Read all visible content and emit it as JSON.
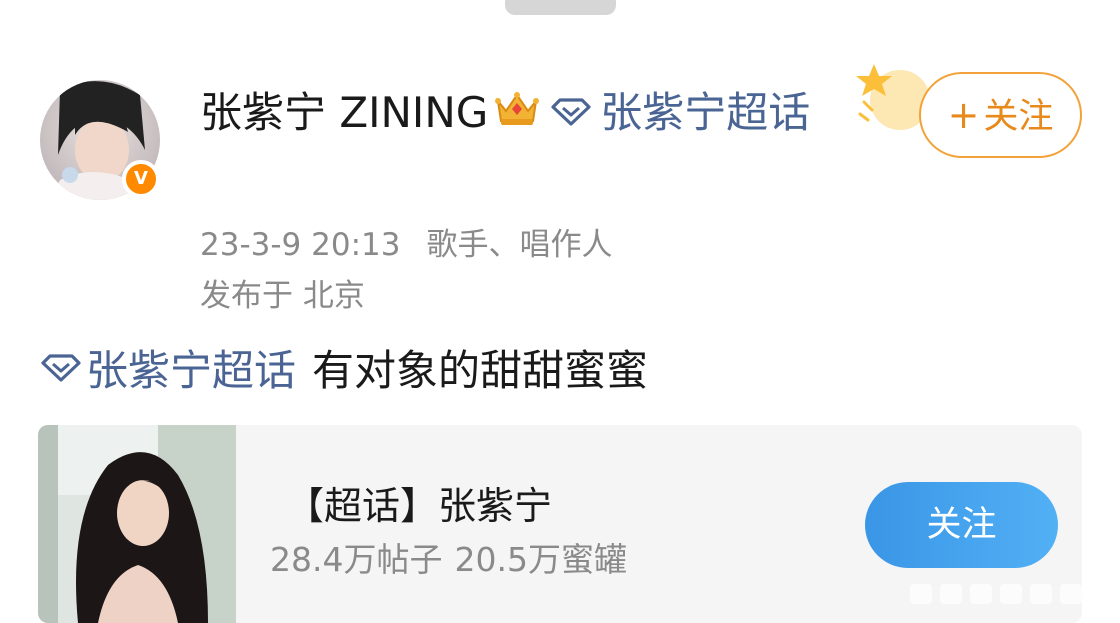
{
  "post": {
    "author": {
      "name": "张紫宁 ZINING",
      "topic_link": "张紫宁超话",
      "verified_badge": "V"
    },
    "timestamp": "23-3-9 20:13",
    "author_title": "歌手、唱作人",
    "location": "发布于 北京",
    "follow_button": {
      "plus": "+",
      "label": "关注"
    },
    "content": {
      "topic_link": "张紫宁超话",
      "text": "有对象的甜甜蜜蜜"
    }
  },
  "topic_card": {
    "title": "【超话】张紫宁",
    "posts_count": "28.4万帖子",
    "fans_count": "20.5万蜜罐",
    "follow_label": "关注"
  },
  "colors": {
    "topic_link": "#4a6494",
    "follow_orange": "#e8891b",
    "card_follow_blue": "#3a96e6",
    "meta_gray": "#8a8a8a"
  },
  "icons": {
    "crown": "crown-icon",
    "diamond": "supertopic-diamond-icon",
    "verified": "verified-badge-icon"
  }
}
